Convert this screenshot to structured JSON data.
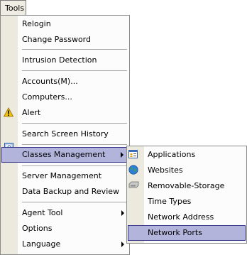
{
  "menubar": {
    "tools_label": "Tools"
  },
  "tools_menu": {
    "items": [
      {
        "label": "Relogin"
      },
      {
        "label": "Change Password"
      },
      {
        "label": "Intrusion Detection"
      },
      {
        "label": "Accounts(M)..."
      },
      {
        "label": "Computers..."
      },
      {
        "label": "Alert",
        "icon": "warning-icon"
      },
      {
        "label": "Search Screen History",
        "icon": "search-screen-history-icon"
      },
      {
        "label": "Classes Management",
        "has_submenu": true,
        "selected": true
      },
      {
        "label": "Server Management"
      },
      {
        "label": "Data Backup and Review"
      },
      {
        "label": "Agent Tool",
        "has_submenu": true
      },
      {
        "label": "Options"
      },
      {
        "label": "Language",
        "has_submenu": true
      }
    ]
  },
  "classes_submenu": {
    "items": [
      {
        "label": "Applications",
        "icon": "applications-icon"
      },
      {
        "label": "Websites",
        "icon": "websites-globe-icon"
      },
      {
        "label": "Removable-Storage",
        "icon": "removable-storage-icon"
      },
      {
        "label": "Time Types"
      },
      {
        "label": "Network Address"
      },
      {
        "label": "Network Ports",
        "selected": true
      }
    ]
  },
  "colors": {
    "highlight_fill": "#b2b4db",
    "highlight_border": "#3a3a8a",
    "gutter": "#ece9de",
    "warning": "#f5c400"
  }
}
